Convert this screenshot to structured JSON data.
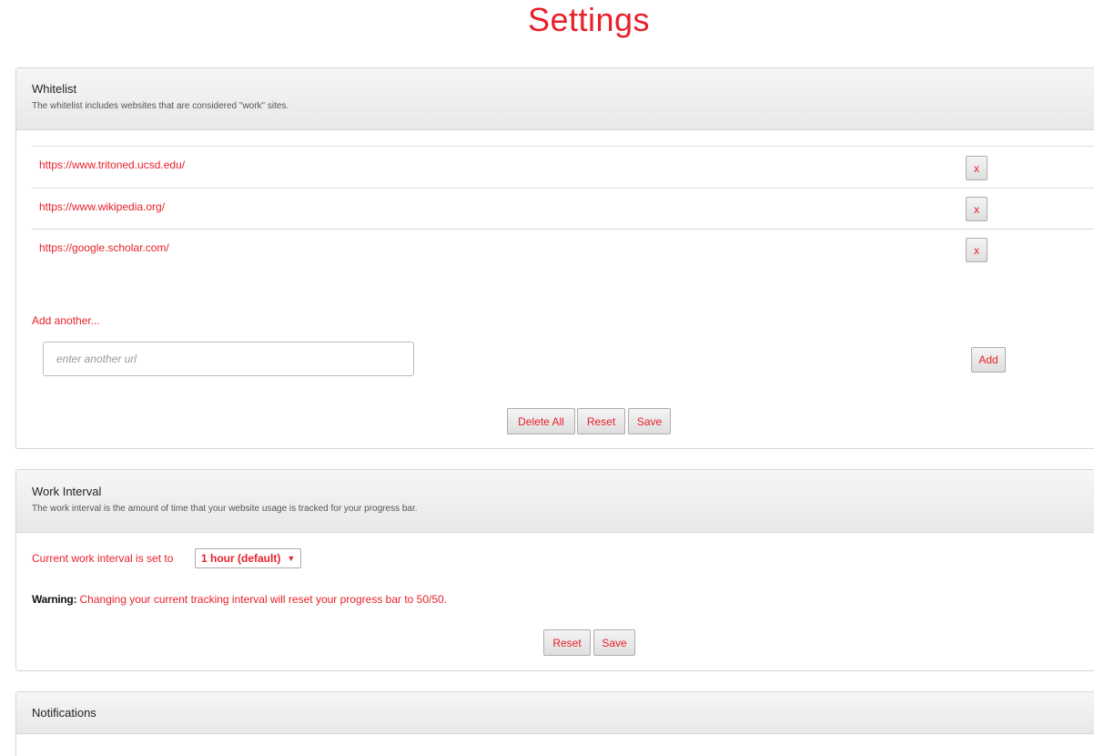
{
  "page": {
    "title": "Settings"
  },
  "whitelist": {
    "title": "Whitelist",
    "description": "The whitelist includes websites that are considered \"work\" sites.",
    "urls": [
      {
        "url": "https://www.tritoned.ucsd.edu/",
        "remove_label": "x"
      },
      {
        "url": "https://www.wikipedia.org/",
        "remove_label": "x"
      },
      {
        "url": "https://google.scholar.com/",
        "remove_label": "x"
      }
    ],
    "add_another_label": "Add another...",
    "input_placeholder": "enter another url",
    "add_button": "Add",
    "delete_all_button": "Delete All",
    "reset_button": "Reset",
    "save_button": "Save"
  },
  "work_interval": {
    "title": "Work Interval",
    "description": "The work interval is the amount of time that your website usage is tracked for your progress bar.",
    "current_label": "Current work interval is set to",
    "selected_option": "1 hour (default)",
    "warning_label": "Warning:",
    "warning_text": "Changing your current tracking interval will reset your progress bar to 50/50.",
    "reset_button": "Reset",
    "save_button": "Save"
  },
  "notifications": {
    "title": "Notifications"
  },
  "colors": {
    "accent": "#e8202a",
    "panel_border": "#d6d6d6"
  }
}
